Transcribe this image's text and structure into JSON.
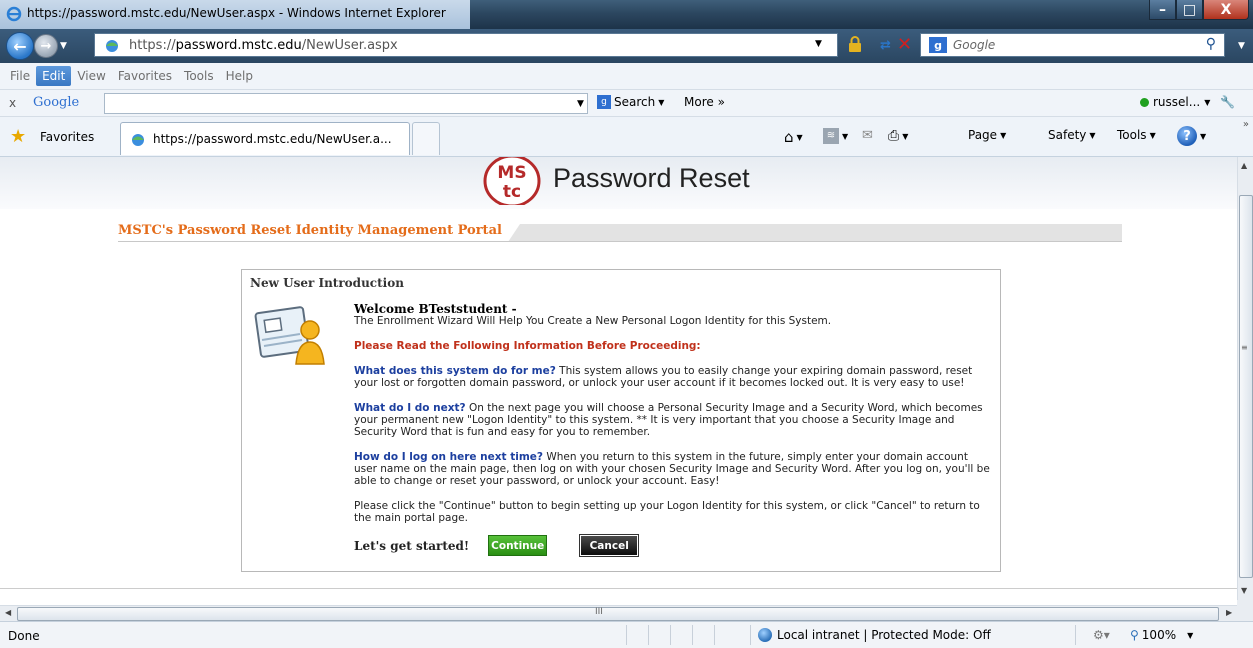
{
  "window": {
    "title": "https://password.mstc.edu/NewUser.aspx - Windows Internet Explorer",
    "minimize": "–",
    "maximize": "□",
    "close": "X"
  },
  "address_bar": {
    "url_prefix": "https://",
    "url_host": "password.mstc.edu",
    "url_path": "/NewUser.aspx",
    "search_placeholder": "Google"
  },
  "menu": {
    "items": [
      "File",
      "Edit",
      "View",
      "Favorites",
      "Tools",
      "Help"
    ],
    "active": "Edit"
  },
  "google_toolbar": {
    "close": "x",
    "logo": "Google",
    "search_label": "Search",
    "more_label": "More »",
    "user": "russel..."
  },
  "favorites_bar": {
    "favorites_label": "Favorites",
    "tab_title": "https://password.mstc.edu/NewUser.a...",
    "page_label": "Page",
    "safety_label": "Safety",
    "tools_label": "Tools"
  },
  "page": {
    "logo_text": "MS tc",
    "title": "Password Reset",
    "portal_title": "MSTC's Password Reset Identity Management Portal",
    "panel_title": "New User Introduction",
    "welcome": "Welcome BTeststudent -",
    "subtitle": "The Enrollment Wizard Will Help You Create a New Personal Logon Identity for this System.",
    "warning": "Please Read the Following Information Before Proceeding:",
    "q1": "What does this system do for me?",
    "a1": " This system allows you to easily change your expiring domain password, reset your lost or forgotten domain password, or unlock your user account if it becomes locked out. It is very easy to use!",
    "q2": "What do I do next?",
    "a2": "  On the next page you will choose a Personal Security Image and a Security Word, which becomes your permanent new \"Logon Identity\" to this system. ** It is very important that you choose a Security Image and Security Word that is fun and easy for you to remember.",
    "q3": "How do I log on here next time?",
    "a3": " When you return to this system in the future, simply enter your domain account user name on the main page, then log on with your chosen Security Image and Security Word. After you log on, you'll be able to change or reset your password, or unlock your account. Easy!",
    "instructions": "Please click the \"Continue\" button to begin setting up your Logon Identity for this system, or click \"Cancel\" to return to the main portal page.",
    "started_label": "Let's get started!",
    "continue_label": "Continue",
    "cancel_label": "Cancel"
  },
  "hscroll": {
    "grip": "III"
  },
  "status_bar": {
    "status": "Done",
    "zone": "Local intranet | Protected Mode: Off",
    "zoom": "100%"
  },
  "colors": {
    "accent_orange": "#e46c1a",
    "question_blue": "#1c3f9f",
    "warning_red": "#c0311b",
    "continue_green": "#2b8f14",
    "logo_red": "#b52a2a"
  }
}
